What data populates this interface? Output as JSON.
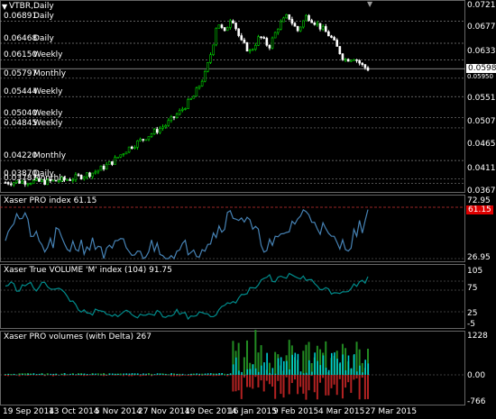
{
  "symbol_title": "VTBR,Daily",
  "current_price": "0.05980",
  "main_price_axis": [
    "0.07210",
    "0.06770",
    "0.06330",
    "0.05950",
    "0.05510",
    "0.05070",
    "0.04650",
    "0.04110",
    "0.03670"
  ],
  "levels": [
    {
      "value": "0.06891",
      "tf": "Daily"
    },
    {
      "value": "0.06468",
      "tf": "Daily"
    },
    {
      "value": "0.06150",
      "tf": "Weekly"
    },
    {
      "value": "0.05797",
      "tf": "Monthly"
    },
    {
      "value": "0.05444",
      "tf": "Weekly"
    },
    {
      "value": "0.05040",
      "tf": "Weekly"
    },
    {
      "value": "0.04845",
      "tf": "Weekly"
    },
    {
      "value": "0.04220",
      "tf": "Monthly"
    },
    {
      "value": "0.03870",
      "tf": "Daily"
    },
    {
      "value": "0.03783",
      "tf": "Monthly"
    }
  ],
  "pane1": {
    "title": "Xaser PRO index 61.15",
    "ticks": [
      "72.95",
      "26.95"
    ],
    "value_box": "61.15"
  },
  "pane2": {
    "title": "Xaser True VOLUME 'M' index (104) 91.75",
    "ticks": [
      "105",
      "75",
      "25",
      "-5"
    ]
  },
  "pane3": {
    "title": "Xaser PRO volumes (with Delta)  267",
    "ticks": [
      "1228",
      "0.00",
      "-766"
    ]
  },
  "x_axis": [
    "19 Sep 2014",
    "13 Oct 2014",
    "5 Nov 2014",
    "27 Nov 2014",
    "19 Dec 2014",
    "16 Jan 2015",
    "9 Feb 2015",
    "4 Mar 2015",
    "27 Mar 2015"
  ],
  "colors": {
    "bull": "#00cc00",
    "bear": "#ffffff",
    "index_line": "#4682b4",
    "vol_line": "#008b8b",
    "up_vol": "#228b22",
    "down_vol": "#b22222",
    "delta": "#00ced1",
    "grid": "#808080"
  }
}
